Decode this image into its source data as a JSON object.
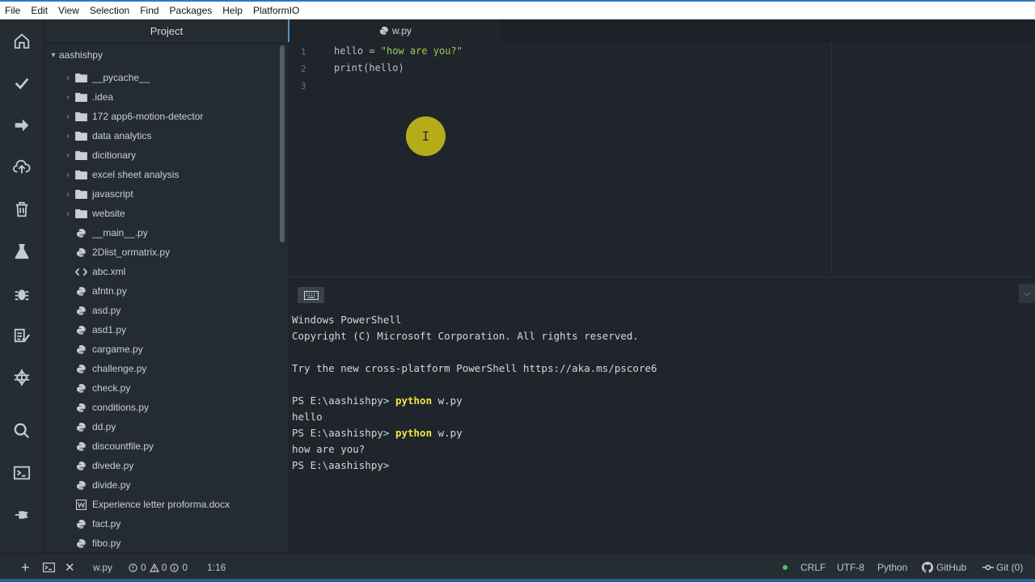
{
  "menu": [
    "File",
    "Edit",
    "View",
    "Selection",
    "Find",
    "Packages",
    "Help",
    "PlatformIO"
  ],
  "left_toolbar_icons": [
    "home-icon",
    "check-icon",
    "arrow-right-icon",
    "cloud-upload-icon",
    "trash-icon",
    "flask-icon",
    "bug-icon",
    "checklist-icon",
    "chip-icon",
    "search-icon",
    "terminal-icon",
    "plug-icon"
  ],
  "project": {
    "title": "Project",
    "root": "aashishpy",
    "folders": [
      "__pycache__",
      ".idea",
      "172 app6-motion-detector",
      "data analytics",
      "dicitionary",
      "excel sheet analysis",
      "javascript",
      "website"
    ],
    "files": [
      {
        "name": "__main__.py",
        "icon": "python-icon"
      },
      {
        "name": "2Dlist_ormatrix.py",
        "icon": "python-icon"
      },
      {
        "name": "abc.xml",
        "icon": "code-icon"
      },
      {
        "name": "afntn.py",
        "icon": "python-icon"
      },
      {
        "name": "asd.py",
        "icon": "python-icon"
      },
      {
        "name": "asd1.py",
        "icon": "python-icon"
      },
      {
        "name": "cargame.py",
        "icon": "python-icon"
      },
      {
        "name": "challenge.py",
        "icon": "python-icon"
      },
      {
        "name": "check.py",
        "icon": "python-icon"
      },
      {
        "name": "conditions.py",
        "icon": "python-icon"
      },
      {
        "name": "dd.py",
        "icon": "python-icon"
      },
      {
        "name": "discountfile.py",
        "icon": "python-icon"
      },
      {
        "name": "divede.py",
        "icon": "python-icon"
      },
      {
        "name": "divide.py",
        "icon": "python-icon"
      },
      {
        "name": "Experience letter proforma.docx",
        "icon": "word-icon"
      },
      {
        "name": "fact.py",
        "icon": "python-icon"
      },
      {
        "name": "fibo.py",
        "icon": "python-icon"
      }
    ]
  },
  "editor": {
    "tab": "w.py",
    "line_numbers": [
      "1",
      "2",
      "3"
    ],
    "line1": {
      "ident": "hello = ",
      "string": "\"how are you?\""
    },
    "line2": "print(hello)"
  },
  "terminal": {
    "lines": [
      "Windows PowerShell",
      "Copyright (C) Microsoft Corporation. All rights reserved.",
      "",
      "Try the new cross-platform PowerShell https://aka.ms/pscore6",
      ""
    ],
    "prompt": "PS E:\\aashishpy> ",
    "cmd1": "python",
    "arg1": " w.py",
    "out1": "hello",
    "cmd2": "python",
    "arg2": " w.py",
    "out2": "how are you?",
    "final_prompt": "PS E:\\aashishpy>"
  },
  "status": {
    "file": "w.py",
    "errors": "0",
    "warnings": "0",
    "infos": "0",
    "position": "1:16",
    "line_ending": "CRLF",
    "encoding": "UTF-8",
    "grammar": "Python",
    "github": "GitHub",
    "git": "Git (0)"
  }
}
